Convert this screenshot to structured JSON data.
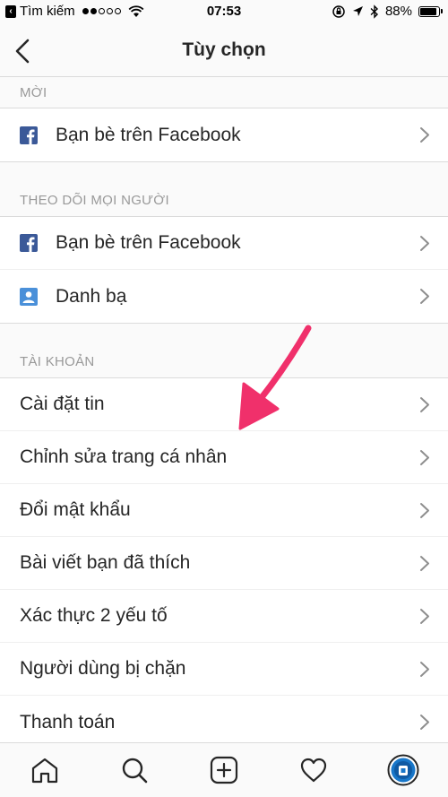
{
  "status_bar": {
    "back_app": "Tìm kiếm",
    "time": "07:53",
    "battery": "88%",
    "battery_level": 0.88
  },
  "nav": {
    "title": "Tùy chọn"
  },
  "sections": {
    "invite": {
      "header": "MỜI",
      "items": [
        {
          "label": "Bạn bè trên Facebook",
          "icon": "facebook-icon"
        }
      ]
    },
    "follow": {
      "header": "THEO DÕI MỌI NGƯỜI",
      "items": [
        {
          "label": "Bạn bè trên Facebook",
          "icon": "facebook-icon"
        },
        {
          "label": "Danh bạ",
          "icon": "contacts-icon"
        }
      ]
    },
    "account": {
      "header": "TÀI KHOẢN",
      "items": [
        {
          "label": "Cài đặt tin"
        },
        {
          "label": "Chỉnh sửa trang cá nhân"
        },
        {
          "label": "Đổi mật khẩu"
        },
        {
          "label": "Bài viết bạn đã thích"
        },
        {
          "label": "Xác thực 2 yếu tố"
        },
        {
          "label": "Người dùng bị chặn"
        },
        {
          "label": "Thanh toán"
        }
      ]
    }
  },
  "tabs": [
    "home-icon",
    "search-icon",
    "add-post-icon",
    "activity-heart-icon",
    "profile-avatar-icon"
  ],
  "colors": {
    "facebook": "#3b5998",
    "contacts": "#4a90d9",
    "annotation_arrow": "#f0306b",
    "profile_ring": "#1877c9"
  }
}
